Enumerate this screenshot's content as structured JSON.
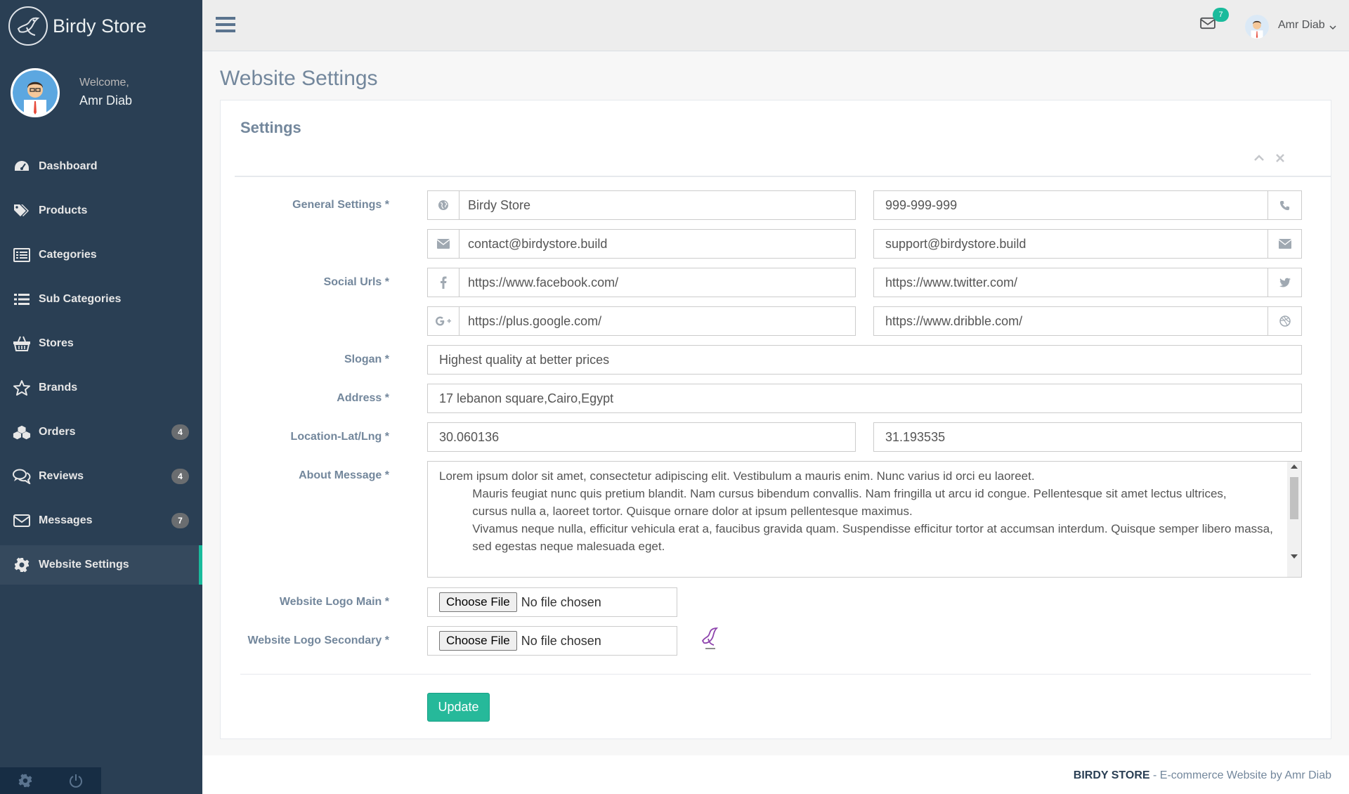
{
  "brand": {
    "title": "Birdy Store",
    "logo_icon": "bird-icon"
  },
  "profile": {
    "welcome": "Welcome,",
    "name": "Amr Diab"
  },
  "sidebar": {
    "items": [
      {
        "label": "Dashboard",
        "icon": "dashboard-icon"
      },
      {
        "label": "Products",
        "icon": "tags-icon"
      },
      {
        "label": "Categories",
        "icon": "list-alt-icon"
      },
      {
        "label": "Sub Categories",
        "icon": "list-icon"
      },
      {
        "label": "Stores",
        "icon": "basket-icon"
      },
      {
        "label": "Brands",
        "icon": "star-icon"
      },
      {
        "label": "Orders",
        "icon": "cubes-icon",
        "badge": "4"
      },
      {
        "label": "Reviews",
        "icon": "comments-icon",
        "badge": "4"
      },
      {
        "label": "Messages",
        "icon": "envelope-icon",
        "badge": "7"
      },
      {
        "label": "Website Settings",
        "icon": "gear-icon",
        "active": true
      }
    ],
    "footer": [
      "settings-icon",
      "power-icon"
    ]
  },
  "topnav": {
    "mail_badge": "7",
    "user_name": "Amr Diab"
  },
  "page": {
    "title": "Website Settings"
  },
  "panel": {
    "title": "Settings"
  },
  "form": {
    "labels": {
      "general": "General Settings",
      "social": "Social Urls",
      "slogan": "Slogan",
      "address": "Address",
      "location": "Location-Lat/Lng",
      "about": "About Message",
      "logo_main": "Website Logo Main",
      "logo_secondary": "Website Logo Secondary",
      "required_mark": "*"
    },
    "site_name": "Birdy Store",
    "phone": "999-999-999",
    "contact_email": "contact@birdystore.build",
    "support_email": "support@birdystore.build",
    "facebook": "https://www.facebook.com/",
    "twitter": "https://www.twitter.com/",
    "google": "https://plus.google.com/",
    "dribbble": "https://www.dribble.com/",
    "slogan": "Highest quality at better prices",
    "address": "17 lebanon square,Cairo,Egypt",
    "lat": "30.060136",
    "lng": "31.193535",
    "about": "Lorem ipsum dolor sit amet, consectetur adipiscing elit. Vestibulum a mauris enim. Nunc varius id orci eu laoreet.\n          Mauris feugiat nunc quis pretium blandit. Nam cursus bibendum convallis. Nam fringilla ut arcu id congue. Pellentesque sit amet lectus ultrices,\n          cursus nulla a, laoreet tortor. Quisque ornare dolor at ipsum pellentesque maximus.\n          Vivamus neque nulla, efficitur vehicula erat a, faucibus gravida quam. Suspendisse efficitur tortor at accumsan interdum. Quisque semper libero massa,\n          sed egestas neque malesuada eget.",
    "file_button": "Choose File",
    "file_status": "No file chosen",
    "update_button": "Update"
  },
  "footer": {
    "brand": "BIRDY STORE",
    "text": " - E-commerce Website by Amr Diab"
  },
  "colors": {
    "sidebar": "#2a3f54",
    "accent": "#1abb9c",
    "button": "#26b99a"
  }
}
